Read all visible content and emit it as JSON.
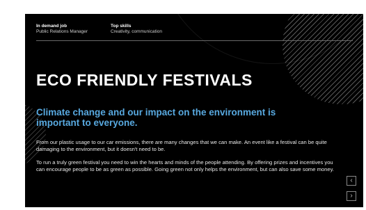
{
  "header": {
    "job_label": "In demand job",
    "job_value": "Public Relations Manager",
    "skills_label": "Top skills",
    "skills_value": "Creativity, communication"
  },
  "slide": {
    "title": "ECO FRIENDLY FESTIVALS",
    "subtitle": "Climate change and our impact on the environment is important to everyone.",
    "paragraph_1": "From our plastic usage to our car emissions, there are many changes that we can make. An event like a festival can be quite damaging to the environment, but it doesn't need to be.",
    "paragraph_2": "To run a truly green festival you need to win the hearts and minds of the people attending. By offering prizes and incentives you can encourage people to be as green as possible. Going green not only helps the environment, but can also save some money."
  },
  "nav": {
    "prev_icon": "chevron-left-icon",
    "next_icon": "chevron-right-icon"
  },
  "colors": {
    "background": "#000000",
    "accent": "#58a9e0",
    "text": "#ffffff"
  }
}
